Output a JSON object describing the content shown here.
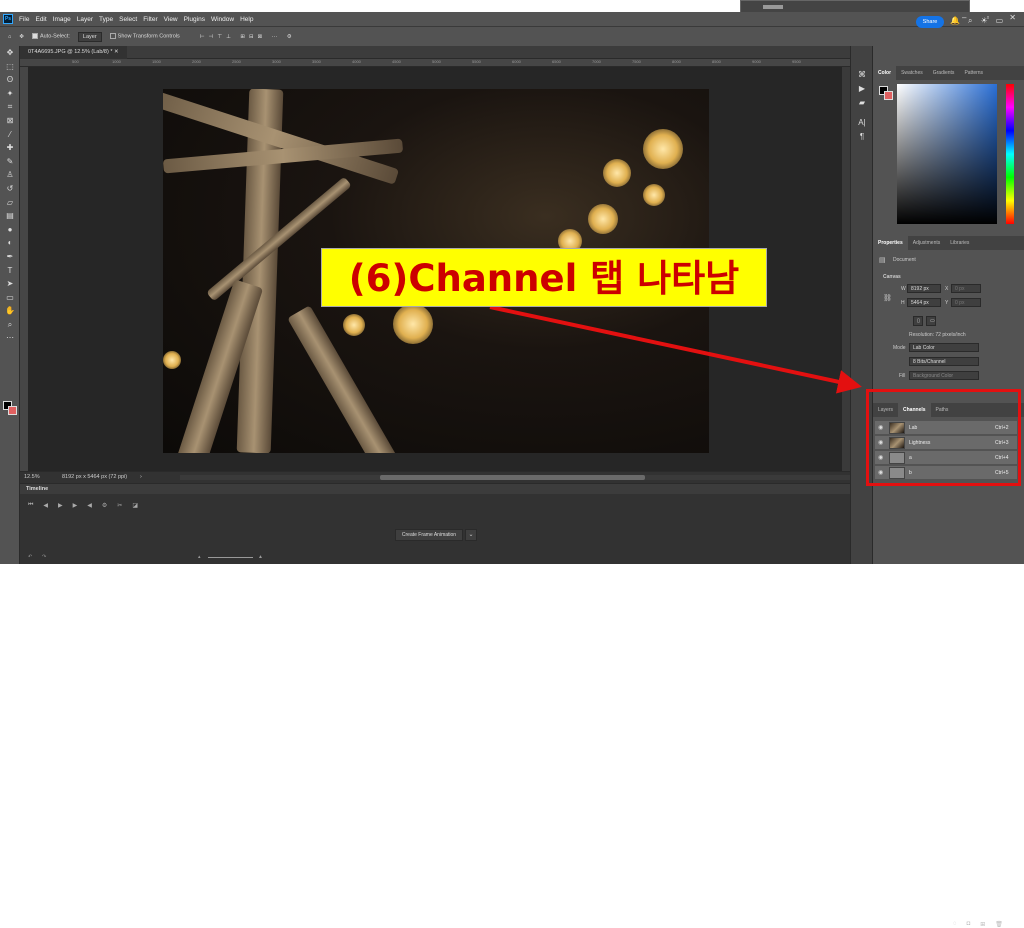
{
  "app": {
    "logo": "Ps"
  },
  "menu": [
    "File",
    "Edit",
    "Image",
    "Layer",
    "Type",
    "Select",
    "Filter",
    "View",
    "Plugins",
    "Window",
    "Help"
  ],
  "options": {
    "auto_select": "Auto-Select:",
    "auto_select_value": "Layer",
    "show_transform": "Show Transform Controls",
    "share": "Share"
  },
  "document": {
    "tab": "0T4A6695.JPG @ 12.5% (Lab/8) *",
    "zoom": "12.5%",
    "size_info": "8192 px x 5464 px (72 ppi)"
  },
  "ruler": [
    "500",
    "1000",
    "1500",
    "2000",
    "2500",
    "3000",
    "3500",
    "4000",
    "4500",
    "5000",
    "5500",
    "6000",
    "6500",
    "7000",
    "7500",
    "8000",
    "8500",
    "9000",
    "9500",
    "10000"
  ],
  "timeline": {
    "title": "Timeline",
    "create_button": "Create Frame Animation"
  },
  "color_panel": {
    "tabs": [
      "Color",
      "Swatches",
      "Gradients",
      "Patterns"
    ]
  },
  "properties": {
    "tabs": [
      "Properties",
      "Adjustments",
      "Libraries"
    ],
    "document_label": "Document",
    "canvas_label": "Canvas",
    "w_label": "W",
    "w_value": "8192 px",
    "h_label": "H",
    "h_value": "5464 px",
    "x_label": "X",
    "x_value": "0 px",
    "y_label": "Y",
    "y_value": "0 px",
    "resolution": "Resolution: 72 pixels/inch",
    "mode_label": "Mode",
    "mode_value": "Lab Color",
    "bits_value": "8 Bits/Channel",
    "fill_label": "Fill",
    "fill_value": "Background Color"
  },
  "channels_panel": {
    "tabs": [
      "Layers",
      "Channels",
      "Paths"
    ],
    "rows": [
      {
        "name": "Lab",
        "shortcut": "Ctrl+2"
      },
      {
        "name": "Lightness",
        "shortcut": "Ctrl+3"
      },
      {
        "name": "a",
        "shortcut": "Ctrl+4"
      },
      {
        "name": "b",
        "shortcut": "Ctrl+5"
      }
    ]
  },
  "annotation": {
    "callout": "(6)Channel 탭 나타남",
    "accent": "#e31010",
    "callout_bg": "#ffff00"
  },
  "icons": [
    "move-icon",
    "marquee-icon",
    "lasso-icon",
    "magic-wand-icon",
    "crop-icon",
    "frame-icon",
    "eyedropper-icon",
    "healing-icon",
    "brush-icon",
    "stamp-icon",
    "history-brush-icon",
    "eraser-icon",
    "gradient-icon",
    "blur-icon",
    "dodge-icon",
    "pen-icon",
    "type-icon",
    "path-select-icon",
    "rectangle-icon",
    "hand-icon",
    "zoom-icon",
    "more-icon"
  ]
}
